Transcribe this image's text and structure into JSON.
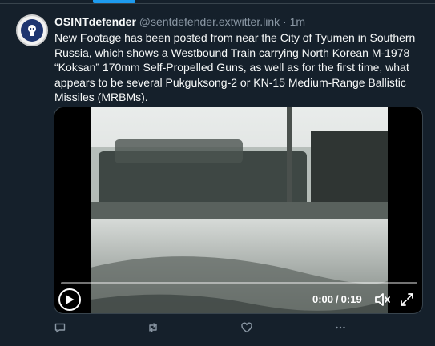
{
  "tweet": {
    "author_name": "OSINTdefender",
    "author_handle": "@sentdefender.extwitter.link",
    "separator": "·",
    "timestamp": "1m",
    "text": "New Footage has been posted from near the City of Tyumen in Southern Russia, which shows a Westbound Train carrying North Korean M-1978 “Koksan” 170mm Self-Propelled Guns, as well as for the first time, what appears to be several Pukguksong-2 or KN-15 Medium-Range Ballistic Missiles (MRBMs)."
  },
  "video": {
    "current_time": "0:00",
    "time_separator": "/",
    "duration": "0:19",
    "progress_fraction": 0.0,
    "accent_color": "#1d9bf0"
  },
  "actions": {
    "icons": [
      "reply-icon",
      "retweet-icon",
      "like-icon",
      "more-icon"
    ]
  },
  "colors": {
    "background": "#15202b",
    "accent": "#1d9bf0",
    "secondary_text": "#8b98a5"
  }
}
